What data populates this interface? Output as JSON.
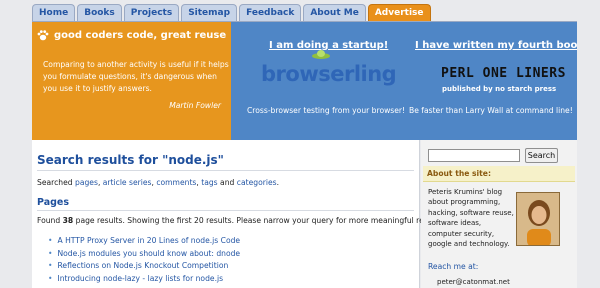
{
  "nav": {
    "tabs": [
      "Home",
      "Books",
      "Projects",
      "Sitemap",
      "Feedback",
      "About Me",
      "Advertise"
    ]
  },
  "header": {
    "brand": "good coders code, great reuse",
    "quote": "Comparing to another activity is useful if it helps you formulate questions, it's dangerous when you use it to justify answers.",
    "quote_author": "Martin Fowler",
    "startup_headline": "I am doing a startup!",
    "startup_logo": "browserling",
    "startup_caption": "Cross-browser testing from your browser!",
    "book_headline": "I have written my fourth book!",
    "book_title": "PERL ONE LINERS",
    "book_publisher": "published by no starch press",
    "book_caption": "Be faster than Larry Wall at command line!"
  },
  "main": {
    "title": "Search results for \"node.js\"",
    "searched_prefix": "Searched",
    "searched_links": [
      "pages",
      "article series",
      "comments",
      "tags",
      "categories"
    ],
    "pages_heading": "Pages",
    "found_prefix": "Found",
    "found_count": "38",
    "found_suffix": "page results. Showing the first 20 results. Please narrow your query for more meaningful results.",
    "results": [
      "A HTTP Proxy Server in 20 Lines of node.js Code",
      "Node.js modules you should know about: dnode",
      "Reflections on Node.js Knockout Competition",
      "Introducing node-lazy - lazy lists for node.js"
    ]
  },
  "sidebar": {
    "search_placeholder": "",
    "search_button": "Search",
    "about_heading": "About the site:",
    "about_text": "Peteris Krumins' blog about programming, hacking, software reuse, software ideas, computer security, google and technology.",
    "reach_label": "Reach me at:",
    "email": "peter@catonmat.net"
  },
  "colors": {
    "accent_orange": "#e7961e",
    "accent_blue": "#4f86c6",
    "link_blue": "#2456a4",
    "heading_blue": "#1e4f9c"
  }
}
